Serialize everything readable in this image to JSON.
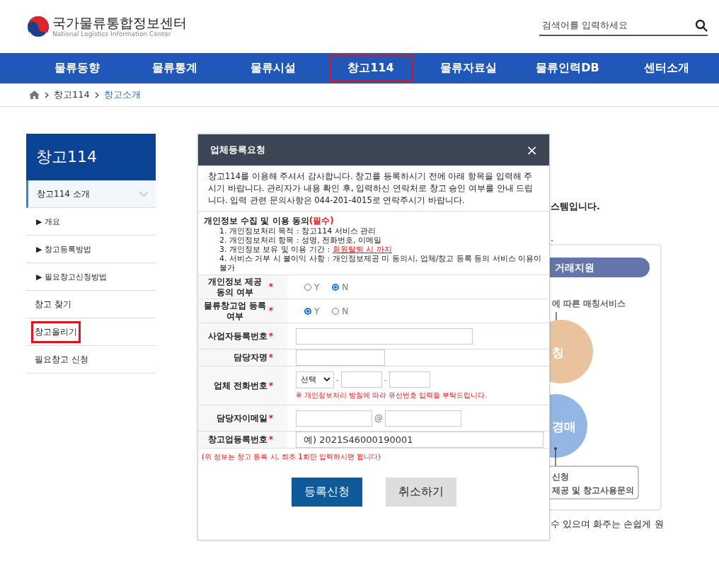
{
  "header": {
    "logo_title": "국가물류통합정보센터",
    "logo_subtitle": "National Logistics Information Center",
    "search": {
      "placeholder": "검색어를 입력하세요"
    }
  },
  "nav": [
    {
      "label": "물류동향",
      "highlighted": false
    },
    {
      "label": "물류통계",
      "highlighted": false
    },
    {
      "label": "물류시설",
      "highlighted": false
    },
    {
      "label": "창고114",
      "highlighted": true
    },
    {
      "label": "물류자료실",
      "highlighted": false
    },
    {
      "label": "물류인력DB",
      "highlighted": false
    },
    {
      "label": "센터소개",
      "highlighted": false
    }
  ],
  "breadcrumb": [
    "창고114",
    "창고소개"
  ],
  "sidebar": {
    "title": "창고114",
    "items": [
      {
        "label": "창고114 소개",
        "selected": true,
        "expanded": true,
        "highlighted": false,
        "children": [
          {
            "label": "▶ 개요"
          },
          {
            "label": "▶ 창고등록방법"
          },
          {
            "label": "▶ 필요창고신청방법"
          }
        ]
      },
      {
        "label": "창고 찾기",
        "selected": false,
        "highlighted": false
      },
      {
        "label": "창고올리기",
        "selected": false,
        "highlighted": true
      },
      {
        "label": "필요창고 신청",
        "selected": false,
        "highlighted": false
      }
    ]
  },
  "background": {
    "text_fragment_1": "스템입니다.",
    "text_fragment_2": ".",
    "diagram": {
      "pill": "거래지원",
      "caption": "에 따른 매칭서비스",
      "circle_1": "칭",
      "circle_2": "경매",
      "box_line_1": "신청",
      "box_line_2": "제공 및 창고사용문의"
    },
    "text_fragment_3": "수 있으며 화주는 손쉽게 원"
  },
  "modal": {
    "title": "업체등록요청",
    "close": "×",
    "intro": "창고114를 이용해 주셔서 감사합니다. 창고를 등록하시기 전에 아래 항목을 입력해 주시기 바랍니다. 관리자가 내용 확인 후, 입력하신 연락처로 창고 승인 여부를 안내 드립니다. 입력 관련 문의사항은 044-201-4015로 연락주시기 바랍니다.",
    "consent": {
      "title": "개인정보 수집 및 이용 동의",
      "required": "(필수)",
      "items": [
        {
          "text": "1. 개인정보처리 목적 : 창고114 서비스 관리"
        },
        {
          "text": "2. 개인정보처리 항목 : 성명, 전화번호, 이메일"
        },
        {
          "text": "3. 개인정보 보유 및 이용 기간 : ",
          "link": "회원탈퇴 시 까지"
        },
        {
          "text": "4. 서비스 거부 시 불이익 사항 : 개인정보제공 미 동의시, 업체/창고 등록 등의 서비스 이용이 불가"
        }
      ]
    },
    "fields": [
      {
        "kind": "radio",
        "label": "개인정보 제공 동의 여부",
        "required_mark": "*",
        "options": [
          {
            "label": "Y",
            "selected": false
          },
          {
            "label": "N",
            "selected": true
          }
        ]
      },
      {
        "kind": "radio",
        "label": "물류창고업 등록여부",
        "required_mark": "*",
        "options": [
          {
            "label": "Y",
            "selected": true
          },
          {
            "label": "N",
            "selected": false
          }
        ]
      },
      {
        "kind": "input",
        "label": "사업자등록번호",
        "required_mark": "*"
      },
      {
        "kind": "shortinput",
        "label": "담당자명",
        "required_mark": "*"
      },
      {
        "kind": "phone",
        "label": "업체 전화번호",
        "required_mark": "*",
        "select": "선택",
        "separator": "-",
        "note": "※ 개인정보처리 방침에 따라 유선번호 입력을 부탁드립니다."
      },
      {
        "kind": "email",
        "label": "담당자이메일",
        "required_mark": "*",
        "separator": "@"
      },
      {
        "kind": "fullinput",
        "label": "창고업등록번호",
        "required_mark": "*",
        "placeholder": "예) 2021S46000190001"
      }
    ],
    "footnote": "(위 정보는 창고 등록 시, 최초 1회만 입력하시면 됩니다)",
    "buttons": [
      {
        "label": "등록신청",
        "kind": "primary"
      },
      {
        "label": "취소하기",
        "kind": "secondary"
      }
    ]
  }
}
